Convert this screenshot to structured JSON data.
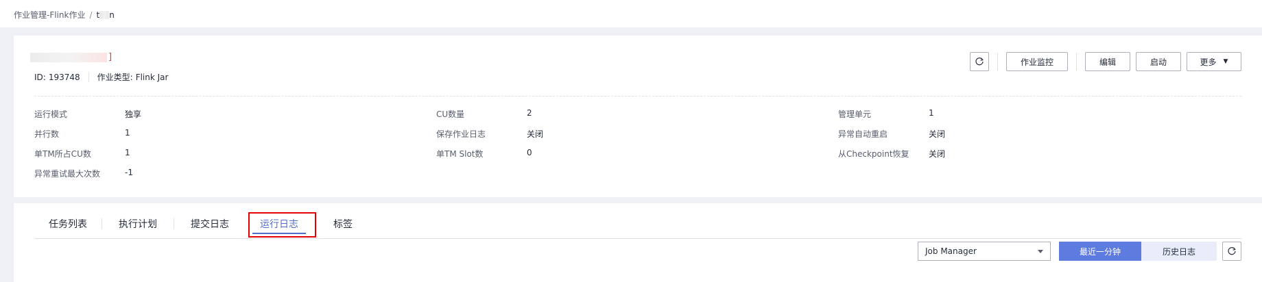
{
  "breadcrumb": {
    "parent": "作业管理-Flink作业",
    "separator": "/",
    "current_prefix": "t",
    "current_suffix": "n"
  },
  "job": {
    "name_suffix": "]",
    "id_label": "ID:",
    "id_value": "193748",
    "type_label": "作业类型:",
    "type_value": "Flink Jar"
  },
  "actions": {
    "refresh_icon": "refresh-icon",
    "monitor": "作业监控",
    "edit": "编辑",
    "start": "启动",
    "more": "更多"
  },
  "properties": [
    {
      "key": "运行模式",
      "value": "独享"
    },
    {
      "key": "CU数量",
      "value": "2"
    },
    {
      "key": "管理单元",
      "value": "1"
    },
    {
      "key": "并行数",
      "value": "1"
    },
    {
      "key": "保存作业日志",
      "value": "关闭"
    },
    {
      "key": "异常自动重启",
      "value": "关闭"
    },
    {
      "key": "单TM所占CU数",
      "value": "1"
    },
    {
      "key": "单TM Slot数",
      "value": "0"
    },
    {
      "key": "从Checkpoint恢复",
      "value": "关闭"
    },
    {
      "key": "异常重试最大次数",
      "value": "-1"
    }
  ],
  "tabs": [
    {
      "label": "任务列表"
    },
    {
      "label": "执行计划"
    },
    {
      "label": "提交日志"
    },
    {
      "label": "运行日志",
      "active": true
    },
    {
      "label": "标签"
    }
  ],
  "log_toolbar": {
    "select_value": "Job Manager",
    "recent_minute": "最近一分钟",
    "history_log": "历史日志"
  },
  "colors": {
    "primary": "#5e7ce0",
    "active_tab": "#526ecc",
    "highlight": "#e30000"
  }
}
